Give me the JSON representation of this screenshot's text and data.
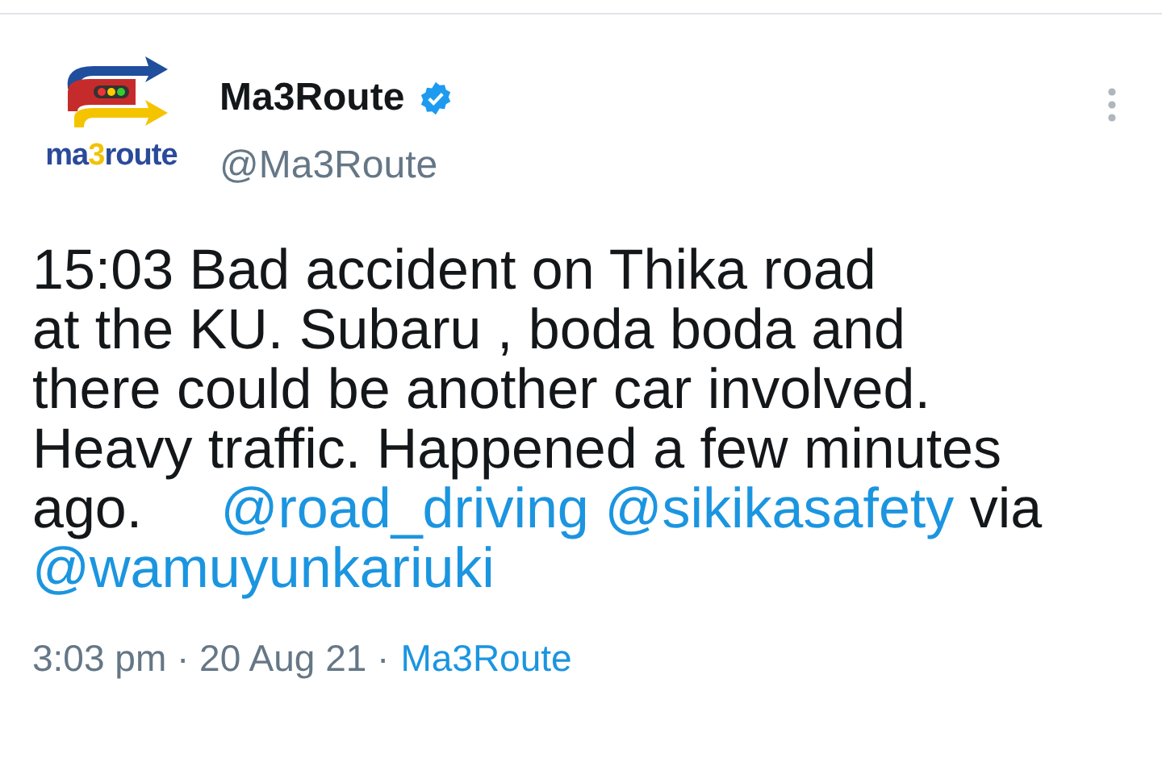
{
  "author": {
    "logo_parts": [
      {
        "text": "ma",
        "color": "#2a4a9a"
      },
      {
        "text": "3",
        "color": "#f2c200"
      },
      {
        "text": "route",
        "color": "#2a4a9a"
      }
    ],
    "name": "Ma3Route",
    "verified": true,
    "handle": "@Ma3Route"
  },
  "body": {
    "lines": [
      [
        {
          "kind": "text",
          "text": "15:03 Bad accident on Thika road"
        }
      ],
      [
        {
          "kind": "text",
          "text": "at the KU. Subaru , boda boda and"
        }
      ],
      [
        {
          "kind": "text",
          "text": "there could be another car involved."
        }
      ],
      [
        {
          "kind": "text",
          "text": "Heavy traffic. Happened a few minutes"
        }
      ],
      [
        {
          "kind": "text",
          "text": "ago.     "
        },
        {
          "kind": "mention",
          "text": "@road_driving"
        },
        {
          "kind": "mention",
          "text": "@sikikasafety"
        },
        {
          "kind": "text",
          "text": " via"
        }
      ],
      [
        {
          "kind": "mention",
          "text": "@wamuyunkariuki"
        }
      ]
    ]
  },
  "meta": {
    "timestamp": "3:03 pm · 20 Aug 21 ·",
    "source": "Ma3Route"
  }
}
